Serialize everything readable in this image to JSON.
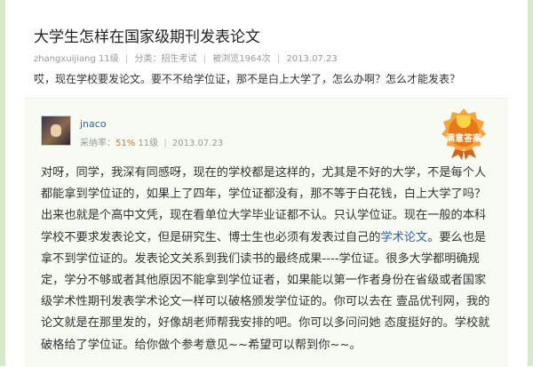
{
  "question": {
    "title": "大学生怎样在国家级期刊发表论文",
    "author": "zhangxuijiang",
    "level": "11级",
    "category_label": "分类：招生考试",
    "views": "被浏览1964次",
    "date": "2013.07.23",
    "body": "哎，现在学校要发论文。要不不给学位证，那不是白上大学了，怎么办啊？怎么才能发表？"
  },
  "answer": {
    "username": "jnaco",
    "rate_label": "采纳率：",
    "rate": "51%",
    "level": "11级",
    "date": "2013.07.23",
    "badge": "满意答案",
    "text_before_link": "对呀，同学，我深有同感呀，现在的学校都是这样的，尤其是不好的大学，不是每个人都能拿到学位证的，如果上了四年，学位证都没有，那不等于白花钱，白上大学了吗？出来也就是个高中文凭，现在看单位大学毕业证都不认。只认学位证。现在一般的本科学校不要求发表论文，但是研究生、博士生也必须有发表过自己的",
    "link_text": "学术论文",
    "text_after_link": "。要么也是拿不到学位证的。发表论文关系到我们读书的最终成果----学位证。很多大学都明确规定，学分不够或者其他原因不能拿到学位证者，如果能以第一作者身份在省级或者国家级学术性期刊发表学术论文一样可以破格颁发学位证的。你可以去在 壹品优刊网，我的论文就是在那里发的，好像胡老师帮我安排的吧。你可以多问问她 态度挺好的。学校就破格给了学位证。给你做个参考意见~~希望可以帮到你~~。"
  },
  "colors": {
    "frame": "#d6ebc9",
    "link": "#2f63a8",
    "rate": "#e46f1b",
    "badge": "#e8781c"
  }
}
